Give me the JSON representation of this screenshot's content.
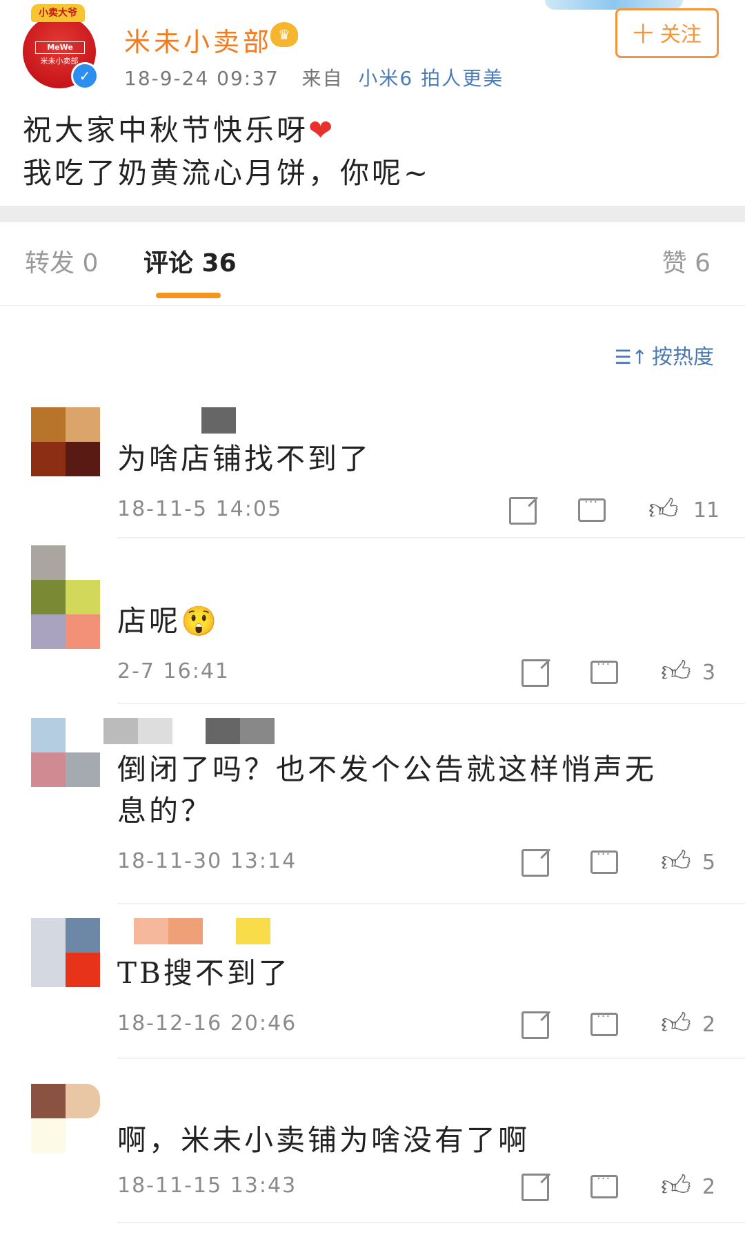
{
  "post": {
    "username": "米未小卖部",
    "crown_text": "小卖大爷",
    "brand_top": "MeWe",
    "brand_sub": "米未小卖部",
    "timestamp": "18-9-24 09:37",
    "from_label": "来自",
    "device": "小米6 拍人更美",
    "follow_label": "十 关注",
    "line1": "祝大家中秋节快乐呀",
    "heart": "❤",
    "line2": "我吃了奶黄流心月饼，你呢~"
  },
  "tabs": {
    "repost": "转发 0",
    "comment": "评论 36",
    "like": "赞 6"
  },
  "sort": {
    "icon": "☰↑",
    "label": "按热度"
  },
  "comments": [
    {
      "text": "为啥店铺找不到了",
      "time": "18-11-5 14:05",
      "likes": "11"
    },
    {
      "text": "店呢😲",
      "time": "2-7 16:41",
      "likes": "3"
    },
    {
      "text": "倒闭了吗？也不发个公告就这样悄声无息的？",
      "time": "18-11-30 13:14",
      "likes": "5"
    },
    {
      "text": "TB搜不到了",
      "time": "18-12-16 20:46",
      "likes": "2"
    },
    {
      "text": "啊，米未小卖铺为啥没有了啊",
      "time": "18-11-15 13:43",
      "likes": "2"
    }
  ],
  "colors": {
    "accent": "#f7941d",
    "username": "#f27b1f",
    "link": "#4a78b2"
  },
  "icons": [
    "share-icon",
    "reply-icon",
    "thumbs-up-icon",
    "verified-icon",
    "vip-icon",
    "sort-icon"
  ]
}
